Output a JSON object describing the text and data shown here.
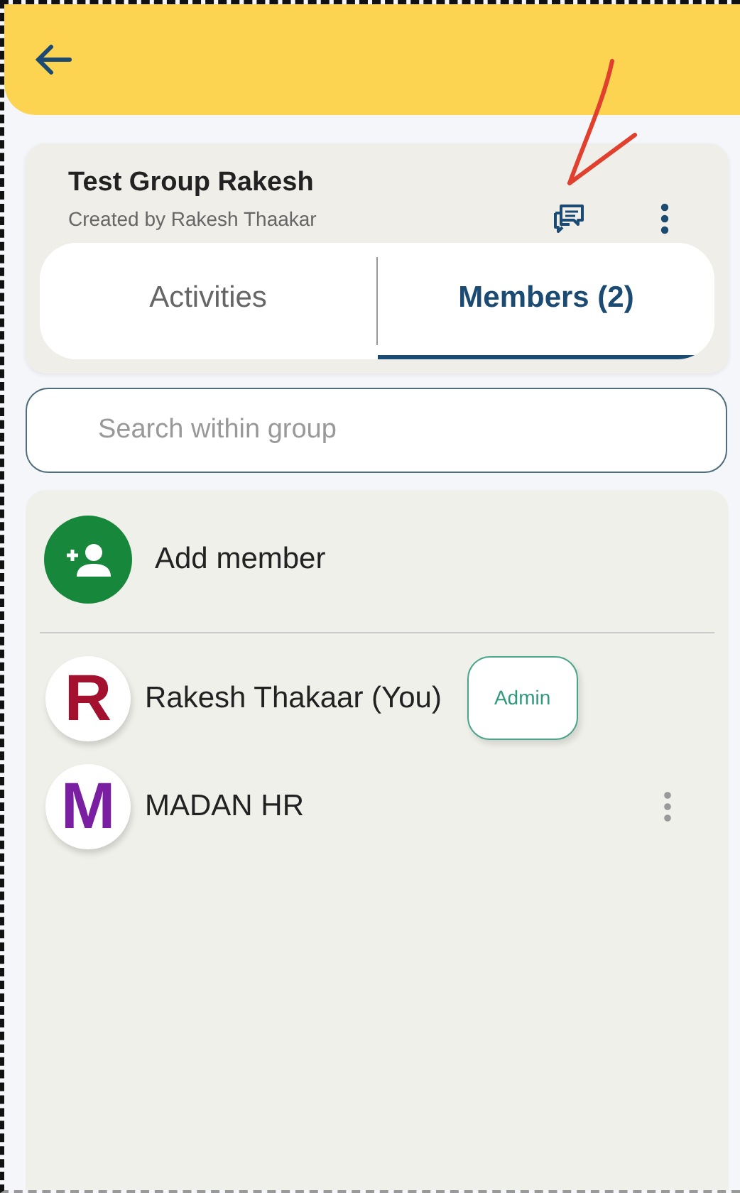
{
  "group": {
    "title": "Test Group Rakesh",
    "subtitle": "Created by Rakesh Thaakar"
  },
  "tabs": [
    {
      "label": "Activities",
      "selected": false
    },
    {
      "label": "Members (2)",
      "selected": true
    }
  ],
  "search": {
    "placeholder": "Search within group"
  },
  "members": [
    {
      "kind": "add",
      "label": "Add member"
    },
    {
      "kind": "member",
      "initial": "R",
      "color": "#a3112e",
      "name": "Rakesh Thakaar (You)",
      "badge": "Admin",
      "menu": false
    },
    {
      "kind": "member",
      "initial": "M",
      "color": "#7b1fa2",
      "name": "MADAN HR",
      "menu": true
    }
  ]
}
